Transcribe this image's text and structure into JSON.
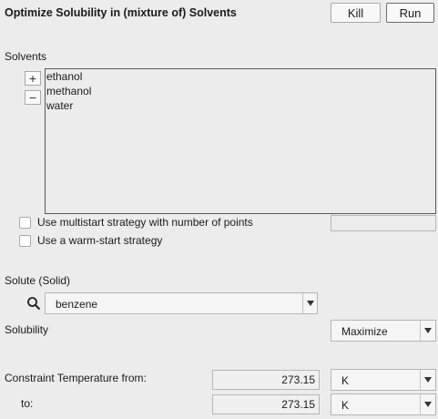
{
  "title": "Optimize Solubility in (mixture of) Solvents",
  "buttons": {
    "kill": "Kill",
    "run": "Run"
  },
  "solvents": {
    "label": "Solvents",
    "add": "+",
    "remove": "−",
    "items": [
      "ethanol",
      "methanol",
      "water"
    ]
  },
  "options": {
    "multistart": "Use multistart strategy with number of points",
    "warmstart": "Use a warm-start strategy"
  },
  "solute": {
    "label": "Solute (Solid)",
    "value": "benzene"
  },
  "solubility": {
    "label": "Solubility",
    "value": "Maximize"
  },
  "constraint": {
    "from_label": "Constraint Temperature from:",
    "to_label": "to:",
    "from_value": "273.15",
    "to_value": "273.15",
    "from_unit": "K",
    "to_unit": "K"
  }
}
